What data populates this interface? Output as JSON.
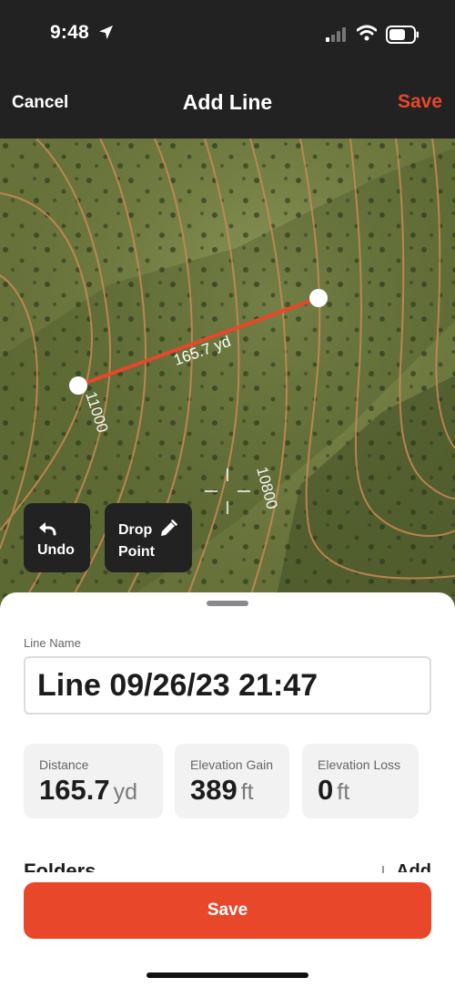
{
  "status_bar": {
    "time": "9:48"
  },
  "nav": {
    "cancel_label": "Cancel",
    "title": "Add Line",
    "save_label": "Save"
  },
  "map": {
    "line_distance_label": "165.7 yd",
    "contour_label_left": "11000",
    "contour_label_right": "10800",
    "line_color": "#e8472a"
  },
  "map_controls": {
    "undo_label": "Undo",
    "drop_point_label": "Drop Point"
  },
  "sheet": {
    "line_name_label": "Line Name",
    "line_name_value": "Line 09/26/23 21:47",
    "stats": {
      "distance": {
        "label": "Distance",
        "value": "165.7",
        "unit": "yd"
      },
      "elevation_gain": {
        "label": "Elevation Gain",
        "value": "389",
        "unit": "ft"
      },
      "elevation_loss": {
        "label": "Elevation Loss",
        "value": "0",
        "unit": "ft"
      }
    },
    "folders_label": "Folders",
    "folders_add_label": "Add",
    "save_label": "Save"
  },
  "colors": {
    "accent": "#e8472a",
    "header_bg": "#222222"
  },
  "icons": [
    "location-arrow-icon",
    "signal-icon",
    "wifi-icon",
    "battery-icon",
    "undo-icon",
    "pencil-icon",
    "crosshair-icon"
  ]
}
